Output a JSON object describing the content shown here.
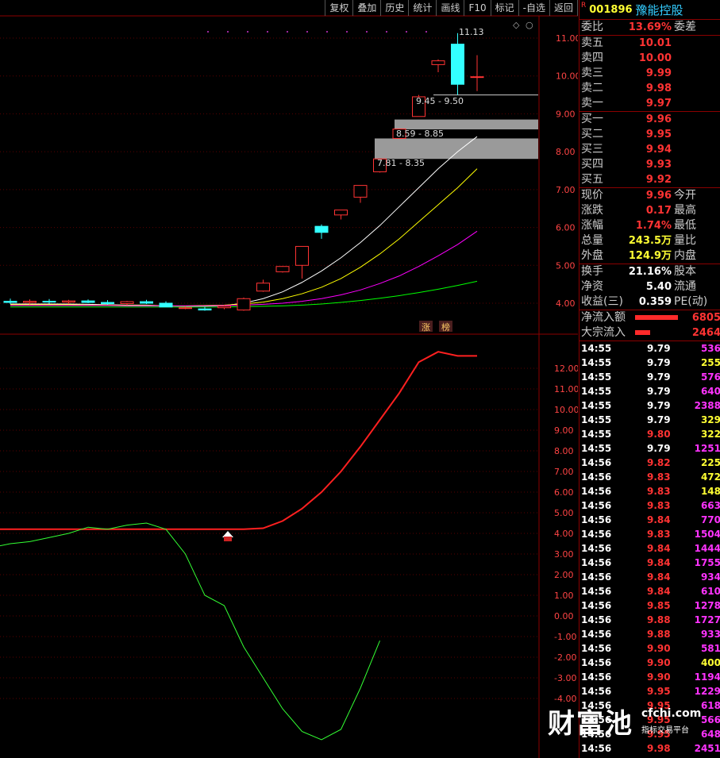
{
  "toolbar": {
    "items": [
      "复权",
      "叠加",
      "历史",
      "统计",
      "画线",
      "F10",
      "标记",
      "-自选",
      "返回"
    ]
  },
  "stock": {
    "flag": "R",
    "code": "001896",
    "name": "豫能控股"
  },
  "order_book": {
    "weibi": {
      "label": "委比",
      "value": "13.69%",
      "label2": "委差"
    },
    "asks": [
      {
        "label": "卖五",
        "price": "10.01"
      },
      {
        "label": "卖四",
        "price": "10.00"
      },
      {
        "label": "卖三",
        "price": "9.99"
      },
      {
        "label": "卖二",
        "price": "9.98"
      },
      {
        "label": "卖一",
        "price": "9.97"
      }
    ],
    "bids": [
      {
        "label": "买一",
        "price": "9.96"
      },
      {
        "label": "买二",
        "price": "9.95"
      },
      {
        "label": "买三",
        "price": "9.94"
      },
      {
        "label": "买四",
        "price": "9.93"
      },
      {
        "label": "买五",
        "price": "9.92"
      }
    ]
  },
  "quote": [
    {
      "label": "现价",
      "value": "9.96",
      "label2": "今开"
    },
    {
      "label": "涨跌",
      "value": "0.17",
      "label2": "最高"
    },
    {
      "label": "涨幅",
      "value": "1.74%",
      "label2": "最低"
    },
    {
      "label": "总量",
      "value": "243.5万",
      "label2": "量比"
    },
    {
      "label": "外盘",
      "value": "124.9万",
      "label2": "内盘"
    }
  ],
  "stats": [
    {
      "label": "换手",
      "value": "21.16%",
      "label2": "股本"
    },
    {
      "label": "净资",
      "value": "5.40",
      "label2": "流通"
    },
    {
      "label": "收益(三)",
      "value": "0.359",
      "label2": "PE(动)"
    }
  ],
  "flows": [
    {
      "label": "净流入额",
      "value": "6805",
      "fill": 1.0
    },
    {
      "label": "大宗流入",
      "value": "2464",
      "fill": 0.36
    }
  ],
  "ticks": [
    {
      "time": "14:55",
      "price": "9.79",
      "vol": "536",
      "pc": "wht",
      "vc": "mag"
    },
    {
      "time": "14:55",
      "price": "9.79",
      "vol": "255",
      "pc": "wht",
      "vc": "yel"
    },
    {
      "time": "14:55",
      "price": "9.79",
      "vol": "576",
      "pc": "wht",
      "vc": "mag"
    },
    {
      "time": "14:55",
      "price": "9.79",
      "vol": "640",
      "pc": "wht",
      "vc": "mag"
    },
    {
      "time": "14:55",
      "price": "9.79",
      "vol": "2388",
      "pc": "wht",
      "vc": "mag"
    },
    {
      "time": "14:55",
      "price": "9.79",
      "vol": "329",
      "pc": "wht",
      "vc": "yel"
    },
    {
      "time": "14:55",
      "price": "9.80",
      "vol": "322",
      "pc": "red",
      "vc": "yel"
    },
    {
      "time": "14:55",
      "price": "9.79",
      "vol": "1251",
      "pc": "wht",
      "vc": "mag"
    },
    {
      "time": "14:56",
      "price": "9.82",
      "vol": "225",
      "pc": "red",
      "vc": "yel"
    },
    {
      "time": "14:56",
      "price": "9.83",
      "vol": "472",
      "pc": "red",
      "vc": "yel"
    },
    {
      "time": "14:56",
      "price": "9.83",
      "vol": "148",
      "pc": "red",
      "vc": "yel"
    },
    {
      "time": "14:56",
      "price": "9.83",
      "vol": "663",
      "pc": "red",
      "vc": "mag"
    },
    {
      "time": "14:56",
      "price": "9.84",
      "vol": "770",
      "pc": "red",
      "vc": "mag"
    },
    {
      "time": "14:56",
      "price": "9.83",
      "vol": "1504",
      "pc": "red",
      "vc": "mag"
    },
    {
      "time": "14:56",
      "price": "9.84",
      "vol": "1444",
      "pc": "red",
      "vc": "mag"
    },
    {
      "time": "14:56",
      "price": "9.84",
      "vol": "1755",
      "pc": "red",
      "vc": "mag"
    },
    {
      "time": "14:56",
      "price": "9.84",
      "vol": "934",
      "pc": "red",
      "vc": "mag"
    },
    {
      "time": "14:56",
      "price": "9.84",
      "vol": "610",
      "pc": "red",
      "vc": "mag"
    },
    {
      "time": "14:56",
      "price": "9.85",
      "vol": "1278",
      "pc": "red",
      "vc": "mag"
    },
    {
      "time": "14:56",
      "price": "9.88",
      "vol": "1727",
      "pc": "red",
      "vc": "mag"
    },
    {
      "time": "14:56",
      "price": "9.88",
      "vol": "933",
      "pc": "red",
      "vc": "mag"
    },
    {
      "time": "14:56",
      "price": "9.90",
      "vol": "581",
      "pc": "red",
      "vc": "mag"
    },
    {
      "time": "14:56",
      "price": "9.90",
      "vol": "400",
      "pc": "red",
      "vc": "yel"
    },
    {
      "time": "14:56",
      "price": "9.90",
      "vol": "1194",
      "pc": "red",
      "vc": "mag"
    },
    {
      "time": "14:56",
      "price": "9.95",
      "vol": "1229",
      "pc": "red",
      "vc": "mag"
    },
    {
      "time": "14:56",
      "price": "9.95",
      "vol": "618",
      "pc": "red",
      "vc": "mag"
    },
    {
      "time": "14:56",
      "price": "9.95",
      "vol": "566",
      "pc": "red",
      "vc": "mag"
    },
    {
      "time": "14:56",
      "price": "9.95",
      "vol": "648",
      "pc": "red",
      "vc": "mag"
    },
    {
      "time": "14:56",
      "price": "9.98",
      "vol": "2451",
      "pc": "red",
      "vc": "mag"
    }
  ],
  "chart_data": {
    "type": "candlestick",
    "price_axis": {
      "ticks": [
        "11.00",
        "10.00",
        "9.00",
        "8.00",
        "7.00",
        "6.00",
        "5.00",
        "4.00"
      ]
    },
    "candles": [
      {
        "o": 4.05,
        "h": 4.12,
        "l": 3.98,
        "c": 4.02
      },
      {
        "o": 4.02,
        "h": 4.1,
        "l": 3.97,
        "c": 4.05
      },
      {
        "o": 4.05,
        "h": 4.11,
        "l": 3.99,
        "c": 4.03
      },
      {
        "o": 4.03,
        "h": 4.09,
        "l": 3.98,
        "c": 4.06
      },
      {
        "o": 4.06,
        "h": 4.1,
        "l": 4.0,
        "c": 4.02
      },
      {
        "o": 4.02,
        "h": 4.08,
        "l": 3.96,
        "c": 3.99
      },
      {
        "o": 3.99,
        "h": 4.06,
        "l": 3.95,
        "c": 4.04
      },
      {
        "o": 4.04,
        "h": 4.09,
        "l": 3.98,
        "c": 4.0
      },
      {
        "o": 4.0,
        "h": 4.05,
        "l": 3.93,
        "c": 3.9
      },
      {
        "o": 3.87,
        "h": 3.92,
        "l": 3.84,
        "c": 3.88
      },
      {
        "o": 3.85,
        "h": 3.9,
        "l": 3.8,
        "c": 3.82
      },
      {
        "o": 3.88,
        "h": 3.95,
        "l": 3.84,
        "c": 3.92
      },
      {
        "o": 3.82,
        "h": 4.15,
        "l": 3.8,
        "c": 4.12
      },
      {
        "o": 4.32,
        "h": 4.62,
        "l": 4.3,
        "c": 4.53
      },
      {
        "o": 4.83,
        "h": 4.98,
        "l": 4.81,
        "c": 4.97
      },
      {
        "o": 5.0,
        "h": 5.5,
        "l": 4.65,
        "c": 5.5
      },
      {
        "o": 6.03,
        "h": 6.08,
        "l": 5.7,
        "c": 5.87
      },
      {
        "o": 6.33,
        "h": 6.46,
        "l": 6.21,
        "c": 6.46
      },
      {
        "o": 6.8,
        "h": 7.11,
        "l": 6.65,
        "c": 7.11
      },
      {
        "o": 7.47,
        "h": 7.81,
        "l": 7.45,
        "c": 7.81
      },
      {
        "o": 8.35,
        "h": 8.59,
        "l": 8.35,
        "c": 8.6
      },
      {
        "o": 8.93,
        "h": 9.5,
        "l": 8.93,
        "c": 9.45
      },
      {
        "o": 10.3,
        "h": 10.44,
        "l": 10.1,
        "c": 10.4
      },
      {
        "o": 10.84,
        "h": 11.13,
        "l": 9.5,
        "c": 9.78
      },
      {
        "o": 9.96,
        "h": 10.55,
        "l": 9.6,
        "c": 9.98
      }
    ],
    "annotations": [
      {
        "price": 11.13,
        "text": "11.13"
      },
      {
        "price": 9.45,
        "text": "9.45 - 9.50"
      },
      {
        "price": 8.59,
        "text": "8.59 - 8.85"
      },
      {
        "price": 7.81,
        "text": "7.81 - 8.35"
      }
    ],
    "gap_zones": [
      {
        "from": 8.59,
        "to": 8.85
      },
      {
        "from": 7.81,
        "to": 8.35
      }
    ],
    "resistance_line": 9.5,
    "ma_lines": [
      {
        "color": "#ffffff",
        "values": [
          3.98,
          3.98,
          3.98,
          3.98,
          3.97,
          3.96,
          3.95,
          3.95,
          3.93,
          3.92,
          3.92,
          3.94,
          4.0,
          4.12,
          4.3,
          4.55,
          4.85,
          5.2,
          5.6,
          6.05,
          6.55,
          7.05,
          7.55,
          8.0,
          8.4
        ]
      },
      {
        "color": "#ffff00",
        "values": [
          3.96,
          3.96,
          3.96,
          3.96,
          3.95,
          3.95,
          3.94,
          3.94,
          3.93,
          3.93,
          3.94,
          3.95,
          3.98,
          4.03,
          4.12,
          4.25,
          4.42,
          4.65,
          4.95,
          5.3,
          5.7,
          6.15,
          6.6,
          7.05,
          7.55
        ]
      },
      {
        "color": "#ff00ff",
        "values": [
          3.94,
          3.94,
          3.94,
          3.94,
          3.94,
          3.94,
          3.93,
          3.93,
          3.93,
          3.93,
          3.93,
          3.94,
          3.95,
          3.97,
          4.0,
          4.05,
          4.12,
          4.22,
          4.35,
          4.52,
          4.72,
          4.97,
          5.25,
          5.55,
          5.9
        ]
      },
      {
        "color": "#00ff00",
        "values": [
          3.9,
          3.9,
          3.9,
          3.9,
          3.9,
          3.9,
          3.9,
          3.9,
          3.9,
          3.9,
          3.9,
          3.9,
          3.91,
          3.92,
          3.93,
          3.95,
          3.98,
          4.02,
          4.07,
          4.13,
          4.2,
          4.28,
          4.37,
          4.47,
          4.58
        ]
      }
    ],
    "markers": [
      "涨",
      "榜"
    ],
    "indicator": {
      "axis_ticks": [
        "12.00",
        "11.00",
        "10.00",
        "9.00",
        "8.00",
        "7.00",
        "6.00",
        "5.00",
        "4.00",
        "3.00",
        "2.00",
        "1.00",
        "0.00",
        "-1.00",
        "-2.00",
        "-3.00",
        "-4.00"
      ],
      "red_line": [
        4.2,
        4.2,
        4.2,
        4.2,
        4.2,
        4.2,
        4.2,
        4.2,
        4.2,
        4.2,
        4.2,
        4.2,
        4.2,
        4.25,
        4.6,
        5.2,
        6.0,
        7.0,
        8.2,
        9.5,
        10.8,
        12.3,
        12.8,
        12.6,
        12.6
      ],
      "green_line": [
        3.5,
        3.6,
        3.8,
        4.0,
        4.3,
        4.2,
        4.4,
        4.5,
        4.2,
        3.0,
        1.0,
        0.5,
        -1.5,
        -3.0,
        -4.5,
        -5.6,
        -6.0,
        -5.5,
        -3.5,
        -1.2
      ]
    }
  }
}
